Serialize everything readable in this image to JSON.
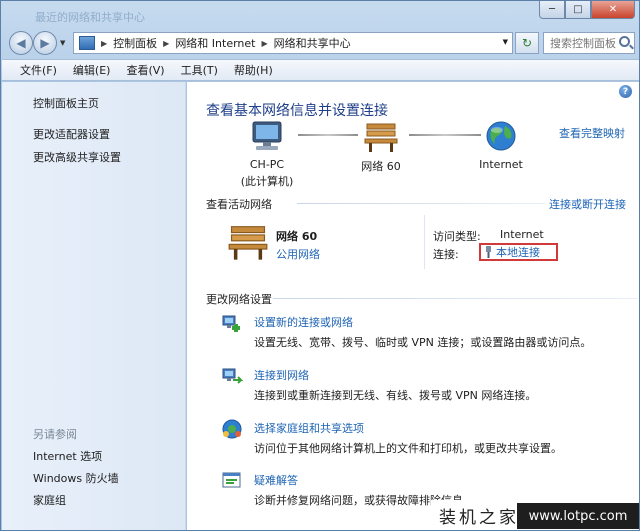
{
  "window": {
    "title": "最近的网络和共享中心",
    "controls": {
      "minimize": "─",
      "maximize": "□",
      "close": "✕"
    }
  },
  "address": {
    "crumbs": [
      "控制面板",
      "网络和 Internet",
      "网络和共享中心"
    ],
    "search_placeholder": "搜索控制面板"
  },
  "menu": [
    "文件(F)",
    "编辑(E)",
    "查看(V)",
    "工具(T)",
    "帮助(H)"
  ],
  "sidebar": {
    "links": [
      "控制面板主页",
      "更改适配器设置",
      "更改高级共享设置"
    ],
    "see_also_heading": "另请参阅",
    "see_also": [
      "Internet 选项",
      "Windows 防火墙",
      "家庭组"
    ]
  },
  "content": {
    "title": "查看基本网络信息并设置连接",
    "see_full_map": "查看完整映射",
    "nodes": [
      {
        "line1": "CH-PC",
        "line2": "(此计算机)",
        "icon": "computer-icon"
      },
      {
        "line1": "网络  60",
        "line2": "",
        "icon": "bench-icon"
      },
      {
        "line1": "Internet",
        "line2": "",
        "icon": "globe-icon"
      }
    ],
    "active_networks_label": "查看活动网络",
    "connect_or_disconnect": "连接或断开连接",
    "active_network": {
      "name": "网络  60",
      "type": "公用网络",
      "access_type_label": "访问类型:",
      "access_type_value": "Internet",
      "connection_label": "连接:",
      "connection_value": "本地连接"
    },
    "change_settings_label": "更改网络设置",
    "tasks": [
      {
        "title": "设置新的连接或网络",
        "desc": "设置无线、宽带、拨号、临时或 VPN 连接；或设置路由器或访问点。",
        "icon": "new-connection-icon"
      },
      {
        "title": "连接到网络",
        "desc": "连接到或重新连接到无线、有线、拨号或 VPN 网络连接。",
        "icon": "connect-network-icon"
      },
      {
        "title": "选择家庭组和共享选项",
        "desc": "访问位于其他网络计算机上的文件和打印机，或更改共享设置。",
        "icon": "homegroup-icon"
      },
      {
        "title": "疑难解答",
        "desc": "诊断并修复网络问题，或获得故障排除信息。",
        "icon": "troubleshoot-icon"
      }
    ]
  },
  "watermark": {
    "text": "装机之家",
    "url": "www.lotpc.com"
  },
  "colors": {
    "link": "#1e64b4",
    "title": "#1e3f8a",
    "highlight_box": "#d23a3a",
    "sidebar_bg": "#e4edf8"
  }
}
